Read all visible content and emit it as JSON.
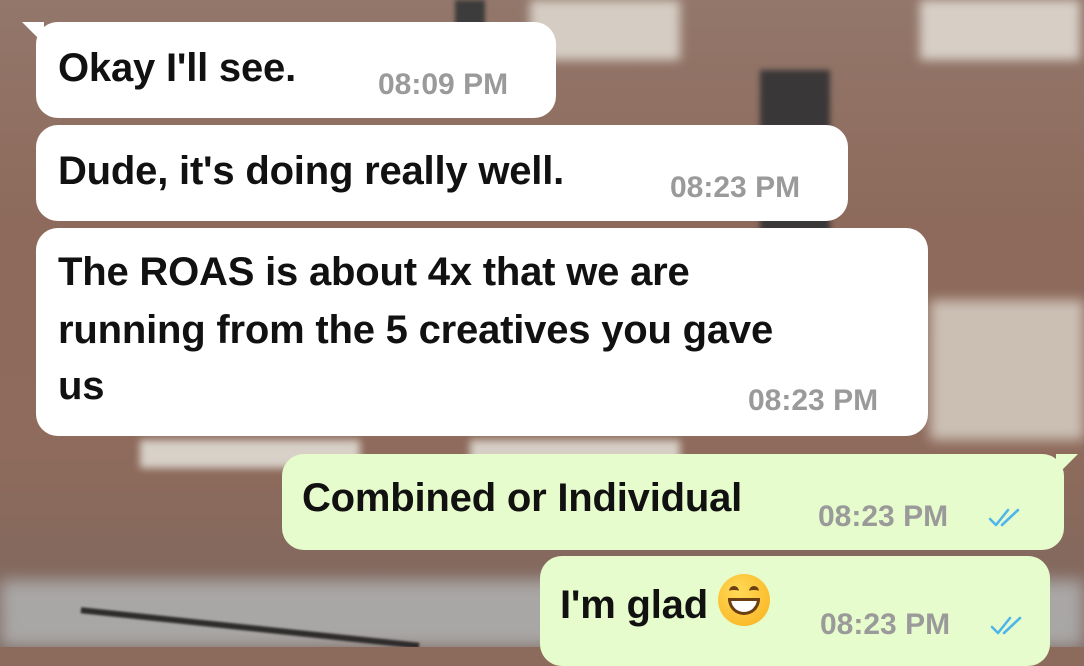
{
  "messages": [
    {
      "id": "m1",
      "direction": "incoming",
      "text": "Okay I'll see.",
      "time": "08:09 PM"
    },
    {
      "id": "m2",
      "direction": "incoming",
      "text": "Dude, it's doing really well.",
      "time": "08:23 PM"
    },
    {
      "id": "m3",
      "direction": "incoming",
      "lines": [
        "The ROAS is about 4x that we are",
        "running from the 5 creatives you gave",
        "us"
      ],
      "time": "08:23 PM"
    },
    {
      "id": "m4",
      "direction": "outgoing",
      "text": "Combined or Individual",
      "time": "08:23 PM",
      "status_icon": "double-check-read-icon"
    },
    {
      "id": "m5",
      "direction": "outgoing",
      "text": "I'm glad",
      "emoji": "grinning-face-with-smiling-eyes-icon",
      "time": "08:23 PM",
      "status_icon": "double-check-read-icon"
    }
  ],
  "colors": {
    "incoming_bubble": "#ffffff",
    "outgoing_bubble": "#e7fccc",
    "timestamp": "#9a9a9a",
    "read_ticks": "#4fb6ec"
  }
}
